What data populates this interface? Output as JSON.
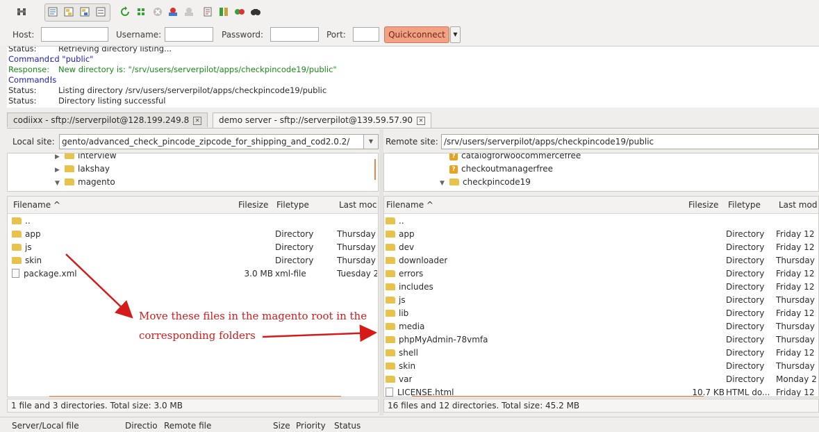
{
  "toolbar": {
    "icons": [
      "site-manager-icon",
      "toggle-log-icon",
      "toggle-local-tree-icon",
      "toggle-remote-tree-icon",
      "toggle-queue-icon",
      "refresh-icon",
      "process-queue-icon",
      "cancel-icon",
      "disconnect-icon",
      "reconnect-icon",
      "filter-icon",
      "compare-icon",
      "sync-browse-icon",
      "search-icon"
    ]
  },
  "quickconnect": {
    "host_label": "Host:",
    "username_label": "Username:",
    "password_label": "Password:",
    "port_label": "Port:",
    "host_value": "",
    "username_value": "",
    "password_value": "",
    "port_value": "",
    "button_label": "Quickconnect",
    "button_color": "#f2a184"
  },
  "log": [
    {
      "key": "Status:",
      "value": "Retrieving directory listing...",
      "kind": "status"
    },
    {
      "key": "Command:",
      "value": "cd \"public\"",
      "kind": "cmd"
    },
    {
      "key": "Response:",
      "value": "New directory is: \"/srv/users/serverpilot/apps/checkpincode19/public\"",
      "kind": "resp"
    },
    {
      "key": "Command:",
      "value": "ls",
      "kind": "cmd"
    },
    {
      "key": "Status:",
      "value": "Listing directory /srv/users/serverpilot/apps/checkpincode19/public",
      "kind": "status"
    },
    {
      "key": "Status:",
      "value": "Directory listing successful",
      "kind": "status"
    }
  ],
  "tabs": [
    {
      "label": "codiixx - sftp://serverpilot@128.199.249.8"
    },
    {
      "label": "demo server - sftp://serverpilot@139.59.57.90"
    }
  ],
  "local": {
    "site_label": "Local site:",
    "site_path": "gento/advanced_check_pincode_zipcode_for_shipping_and_cod2.0.2/",
    "tree": [
      {
        "name": "interview",
        "expander": "▶"
      },
      {
        "name": "lakshay",
        "expander": "▶"
      },
      {
        "name": "magento",
        "expander": "▼"
      }
    ],
    "columns": {
      "filename": "Filename ^",
      "filesize": "Filesize",
      "filetype": "Filetype",
      "lastmod": "Last moc"
    },
    "files": [
      {
        "name": "..",
        "size": "",
        "type": "",
        "mod": "",
        "icon": "folder"
      },
      {
        "name": "app",
        "size": "",
        "type": "Directory",
        "mod": "Thursday",
        "icon": "folder"
      },
      {
        "name": "js",
        "size": "",
        "type": "Directory",
        "mod": "Thursday",
        "icon": "folder"
      },
      {
        "name": "skin",
        "size": "",
        "type": "Directory",
        "mod": "Thursday",
        "icon": "folder"
      },
      {
        "name": "package.xml",
        "size": "3.0 MB",
        "type": "xml-file",
        "mod": "Tuesday 2",
        "icon": "file"
      }
    ],
    "status": "1 file and 3 directories. Total size: 3.0 MB"
  },
  "remote": {
    "site_label": "Remote site:",
    "site_path": "/srv/users/serverpilot/apps/checkpincode19/public",
    "tree": [
      {
        "name": "catalogforwoocommercefree",
        "icon": "q"
      },
      {
        "name": "checkoutmanagerfree",
        "icon": "q"
      },
      {
        "name": "checkpincode19",
        "icon": "folder",
        "expander": "▼"
      }
    ],
    "columns": {
      "filename": "Filename ^",
      "filesize": "Filesize",
      "filetype": "Filetype",
      "lastmod": "Last mod"
    },
    "files": [
      {
        "name": "..",
        "size": "",
        "type": "",
        "mod": "",
        "icon": "folder"
      },
      {
        "name": "app",
        "size": "",
        "type": "Directory",
        "mod": "Friday 12",
        "icon": "folder"
      },
      {
        "name": "dev",
        "size": "",
        "type": "Directory",
        "mod": "Friday 12",
        "icon": "folder"
      },
      {
        "name": "downloader",
        "size": "",
        "type": "Directory",
        "mod": "Thursday",
        "icon": "folder"
      },
      {
        "name": "errors",
        "size": "",
        "type": "Directory",
        "mod": "Friday 12",
        "icon": "folder"
      },
      {
        "name": "includes",
        "size": "",
        "type": "Directory",
        "mod": "Friday 12",
        "icon": "folder"
      },
      {
        "name": "js",
        "size": "",
        "type": "Directory",
        "mod": "Thursday",
        "icon": "folder"
      },
      {
        "name": "lib",
        "size": "",
        "type": "Directory",
        "mod": "Friday 12",
        "icon": "folder"
      },
      {
        "name": "media",
        "size": "",
        "type": "Directory",
        "mod": "Thursday",
        "icon": "folder"
      },
      {
        "name": "phpMyAdmin-78vmfa",
        "size": "",
        "type": "Directory",
        "mod": "Thursday",
        "icon": "folder"
      },
      {
        "name": "shell",
        "size": "",
        "type": "Directory",
        "mod": "Friday 12",
        "icon": "folder"
      },
      {
        "name": "skin",
        "size": "",
        "type": "Directory",
        "mod": "Thursday",
        "icon": "folder"
      },
      {
        "name": "var",
        "size": "",
        "type": "Directory",
        "mod": "Monday 2",
        "icon": "folder"
      },
      {
        "name": "LICENSE.html",
        "size": "10.7 KB",
        "type": "HTML do...",
        "mod": "Friday 12",
        "icon": "file"
      }
    ],
    "status": "16 files and 12 directories. Total size: 45.2 MB"
  },
  "queue": {
    "columns": [
      "Server/Local file",
      "Directio",
      "Remote file",
      "Size",
      "Priority",
      "Status"
    ]
  },
  "annotation": {
    "line1": "Move these files in the magento root in the",
    "line2": "corresponding folders",
    "color": "#d61a1a"
  }
}
